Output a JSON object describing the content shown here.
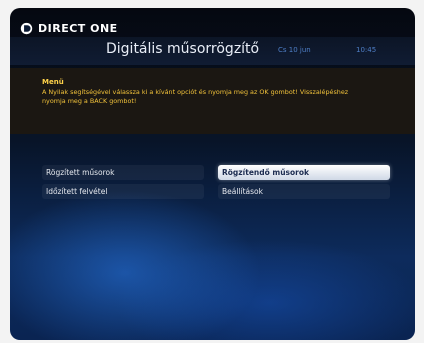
{
  "brand": {
    "logo_text": "DIRECT ONE"
  },
  "header": {
    "title": "Digitális műsorrögzítő",
    "date": "Cs 10 jun",
    "time": "10:45"
  },
  "help": {
    "heading": "Menü",
    "text": "A Nyilak segítségével válassza ki a kívánt opciót és nyomja meg az OK gombot! Visszalépéshez nyomja meg a BACK gombot!"
  },
  "menu": {
    "items": [
      {
        "label": "Rögzített műsorok",
        "selected": false
      },
      {
        "label": "Rögzítendő műsorok",
        "selected": true
      },
      {
        "label": "Időzített felvétel",
        "selected": false
      },
      {
        "label": "Beállítások",
        "selected": false
      }
    ]
  },
  "colors": {
    "accent_date": "#4f7fc7",
    "help_text": "#f0c13a",
    "selected_bg": "#ffffff"
  }
}
